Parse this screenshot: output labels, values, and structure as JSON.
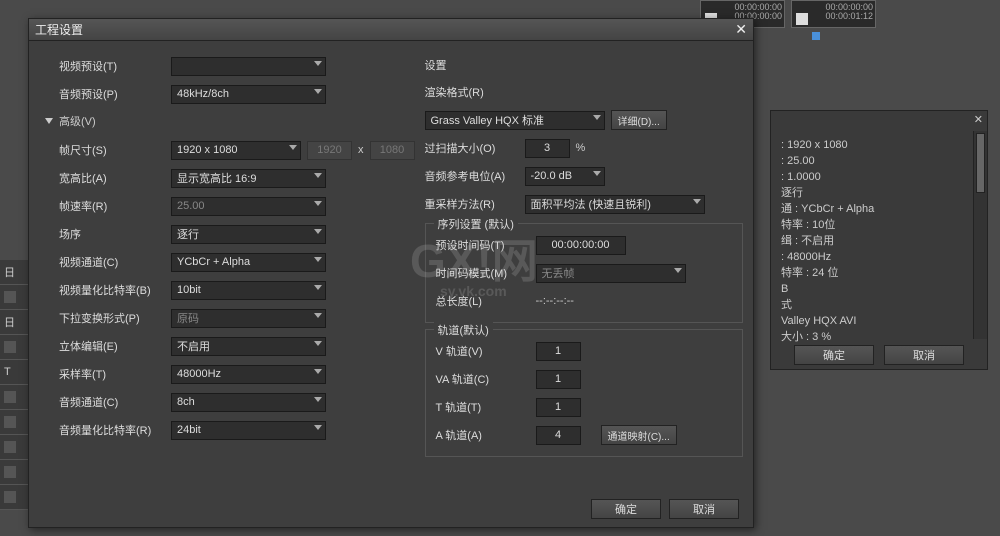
{
  "dialog": {
    "title": "工程设置",
    "left": {
      "video_preset_label": "视频预设(T)",
      "audio_preset_label": "音频预设(P)",
      "audio_preset_value": "48kHz/8ch",
      "advanced_label": "高级(V)",
      "frame_size_label": "帧尺寸(S)",
      "frame_size_value": "1920 x 1080",
      "frame_w": "1920",
      "frame_h": "1080",
      "aspect_label": "宽高比(A)",
      "aspect_value": "显示宽高比 16:9",
      "framerate_label": "帧速率(R)",
      "framerate_value": "25.00",
      "field_label": "场序",
      "field_value": "逐行",
      "vchannel_label": "视频通道(C)",
      "vchannel_value": "YCbCr + Alpha",
      "vqbit_label": "视频量化比特率(B)",
      "vqbit_value": "10bit",
      "pulldown_label": "下拉变换形式(P)",
      "pulldown_value": "原码",
      "stereo_label": "立体编辑(E)",
      "stereo_value": "不启用",
      "sample_label": "采样率(T)",
      "sample_value": "48000Hz",
      "achannel_label": "音频通道(C)",
      "achannel_value": "8ch",
      "aqbit_label": "音频量化比特率(R)",
      "aqbit_value": "24bit"
    },
    "right": {
      "settings_header": "设置",
      "render_fmt_label": "渲染格式(R)",
      "render_fmt_value": "Grass Valley HQX 标准",
      "detail_btn": "详细(D)...",
      "overscan_label": "过扫描大小(O)",
      "overscan_value": "3",
      "overscan_unit": "%",
      "aref_label": "音频参考电位(A)",
      "aref_value": "-20.0 dB",
      "resample_label": "重采样方法(R)",
      "resample_value": "面积平均法 (快速且锐利)",
      "seq_header": "序列设置 (默认)",
      "preset_tc_label": "预设时间码(T)",
      "preset_tc_value": "00:00:00:00",
      "tc_mode_label": "时间码模式(M)",
      "tc_mode_value": "无丢帧",
      "total_len_label": "总长度(L)",
      "total_len_value": "--:--:--:--",
      "track_header": "轨道(默认)",
      "v_track_label": "V 轨道(V)",
      "v_track_value": "1",
      "va_track_label": "VA 轨道(C)",
      "va_track_value": "1",
      "t_track_label": "T 轨道(T)",
      "t_track_value": "1",
      "a_track_label": "A 轨道(A)",
      "a_track_value": "4",
      "chmap_btn": "通道映射(C)..."
    },
    "ok_btn": "确定",
    "cancel_btn": "取消"
  },
  "info_panel": {
    "lines": [
      ": 1920 x 1080",
      ": 25.00",
      ": 1.0000",
      "逐行",
      "通 : YCbCr + Alpha",
      "特率 : 10位",
      "缉 : 不启用",
      "",
      ": 48000Hz",
      "特率 : 24 位",
      "B",
      "",
      "式",
      "Valley HQX AVI",
      "大小 : 3 %"
    ],
    "ok": "确定",
    "cancel": "取消"
  },
  "clips": [
    {
      "tc1": "00:00:00:00",
      "tc2": "00:00:00:00"
    },
    {
      "tc1": "00:00:00:00",
      "tc2": "00:00:01:12"
    }
  ],
  "watermark": {
    "main": "GX!网",
    "sub": "sy.vk.com"
  }
}
